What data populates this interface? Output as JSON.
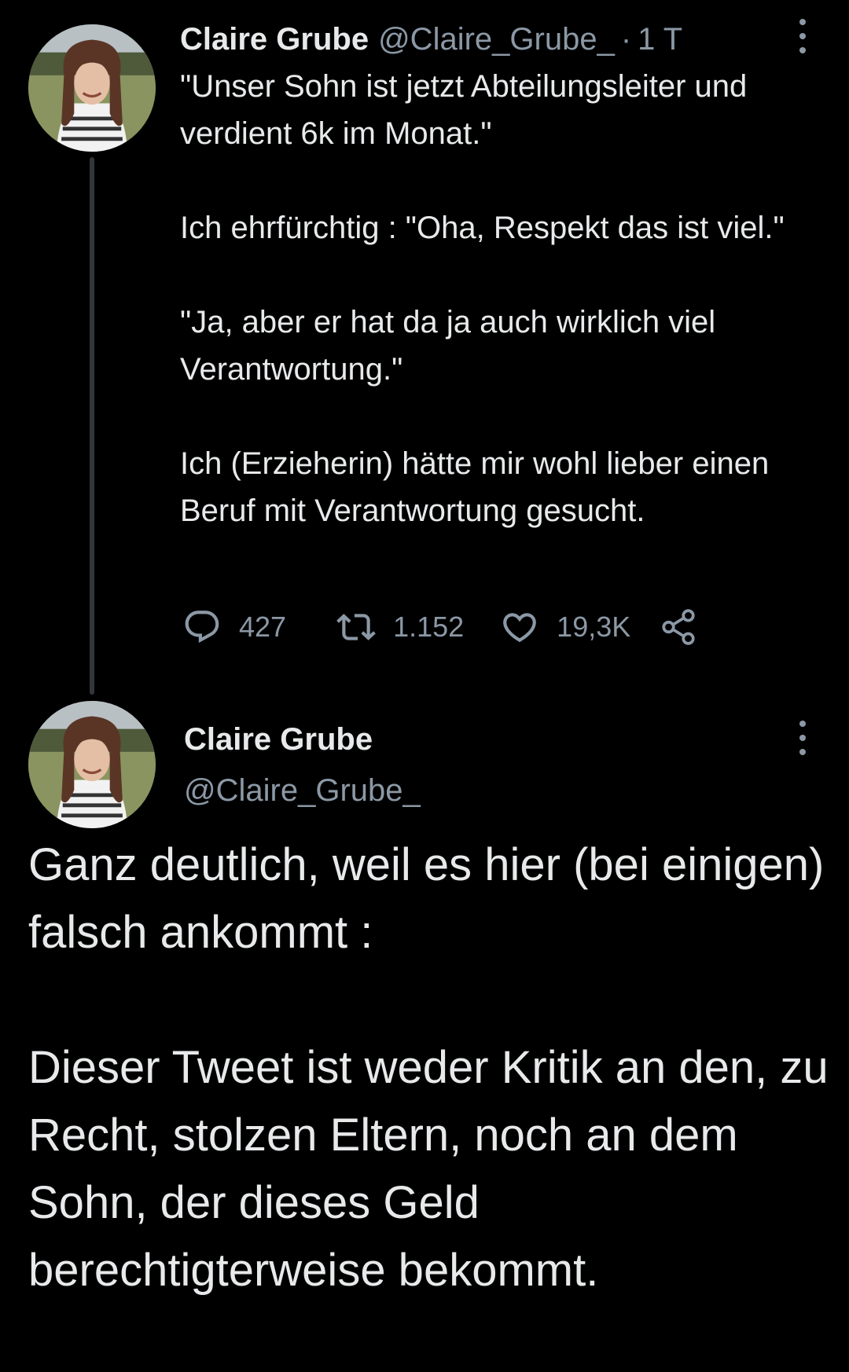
{
  "colors": {
    "background": "#000000",
    "primary_text": "#e7e9ea",
    "secondary_text": "#8b98a5",
    "thread_line": "#333639"
  },
  "tweet1": {
    "avatar_icon": "profile-photo",
    "author_name": "Claire Grube",
    "author_handle": "@Claire_Grube_",
    "separator": "·",
    "timestamp": "1 T",
    "paragraphs": [
      "\"Unser Sohn ist jetzt Abteilungsleiter und verdient 6k im Monat.\"",
      "Ich ehrfürchtig : \"Oha, Respekt das ist viel.\"",
      "\"Ja, aber er hat da ja auch wirklich viel Verantwortung.\"",
      "Ich (Erzieherin) hätte mir wohl lieber einen Beruf mit Verantwortung gesucht."
    ],
    "actions": {
      "reply_icon": "reply-icon",
      "reply_count": "427",
      "retweet_icon": "retweet-icon",
      "retweet_count": "1.152",
      "like_icon": "heart-icon",
      "like_count": "19,3K",
      "share_icon": "share-icon"
    },
    "more_icon": "more-options-icon"
  },
  "tweet2": {
    "avatar_icon": "profile-photo",
    "author_name": "Claire Grube",
    "author_handle": "@Claire_Grube_",
    "more_icon": "more-options-icon",
    "paragraphs": [
      "Ganz deutlich, weil es hier (bei einigen) falsch ankommt :",
      "Dieser Tweet ist weder Kritik an den, zu Recht, stolzen Eltern, noch an dem Sohn, der dieses Geld berechtigterweise bekommt."
    ]
  }
}
